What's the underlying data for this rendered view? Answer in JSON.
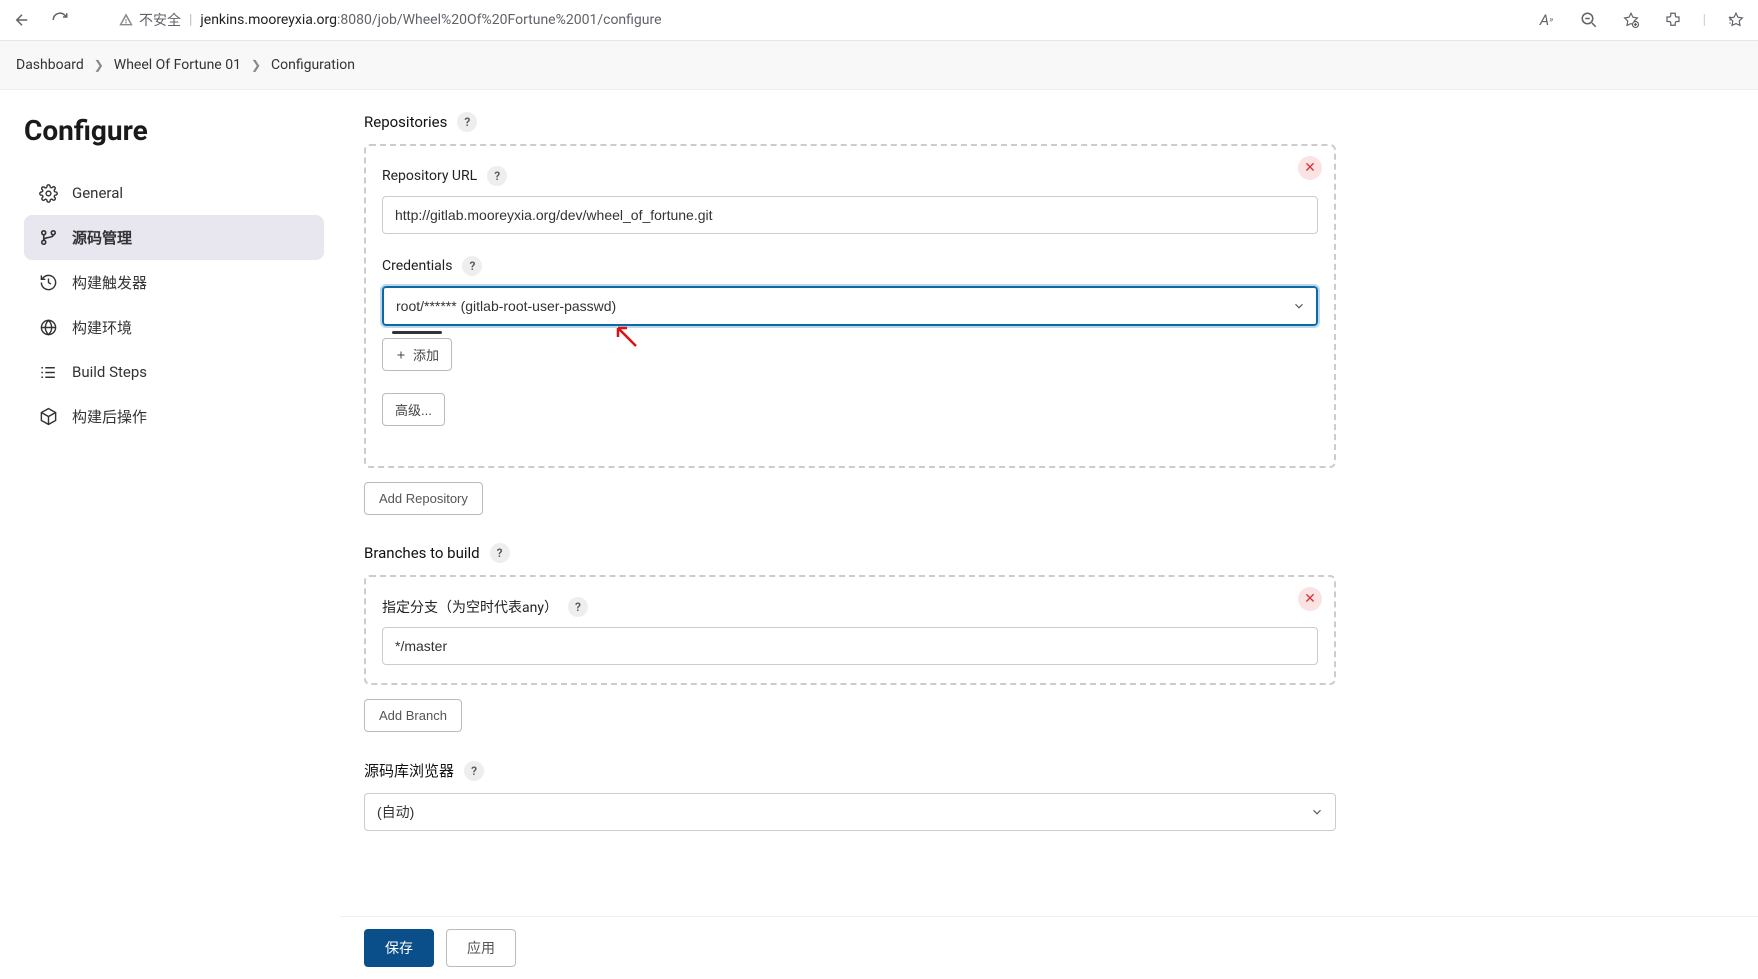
{
  "browser": {
    "not_secure_label": "不安全",
    "url_host": "jenkins.mooreyxia.org",
    "url_port_path": ":8080/job/Wheel%20Of%20Fortune%2001/configure"
  },
  "breadcrumb": {
    "items": [
      "Dashboard",
      "Wheel Of Fortune 01",
      "Configuration"
    ]
  },
  "sidebar": {
    "title": "Configure",
    "items": [
      {
        "label": "General"
      },
      {
        "label": "源码管理"
      },
      {
        "label": "构建触发器"
      },
      {
        "label": "构建环境"
      },
      {
        "label": "Build Steps"
      },
      {
        "label": "构建后操作"
      }
    ],
    "active_index": 1
  },
  "main": {
    "repositories_label": "Repositories",
    "repository_url_label": "Repository URL",
    "repository_url_value": "http://gitlab.mooreyxia.org/dev/wheel_of_fortune.git",
    "credentials_label": "Credentials",
    "credentials_selected": "root/****** (gitlab-root-user-passwd)",
    "add_credential_label": "添加",
    "advanced_label": "高级...",
    "add_repository_label": "Add Repository",
    "branches_label": "Branches to build",
    "branch_spec_label": "指定分支（为空时代表any）",
    "branch_spec_value": "*/master",
    "add_branch_label": "Add Branch",
    "repo_browser_label": "源码库浏览器",
    "repo_browser_selected": "(自动)"
  },
  "footer": {
    "save": "保存",
    "apply": "应用"
  }
}
